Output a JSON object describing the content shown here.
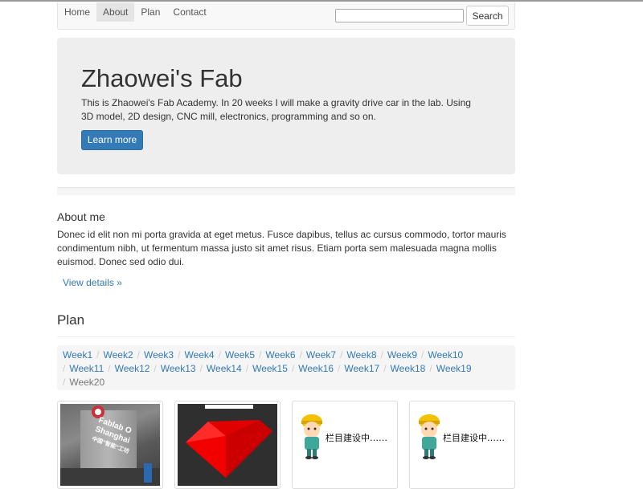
{
  "navbar": {
    "links": [
      "Home",
      "About",
      "Plan",
      "Contact"
    ],
    "active": "About",
    "search": {
      "placeholder": "",
      "button_label": "Search"
    }
  },
  "jumbotron": {
    "title": "Zhaowei's Fab",
    "description": "This is Zhaowei's Fab Academy. In 20 weeks I will make a gravity drive car in the lab. Using 3D model, 2D design, CNC mill, electronics, programming and so on.",
    "button_label": "Learn more",
    "button_color": "#337ab7"
  },
  "about": {
    "title": "About me",
    "text": "Donec id elit non mi porta gravida at eget metus. Fusce dapibus, tellus ac cursus commodo, tortor mauris condimentum nibh, ut fermentum massa justo sit amet risus. Etiam porta sem malesuada magna mollis euismod. Donec sed odio dui.",
    "link_label": "View details »"
  },
  "plan": {
    "title": "Plan",
    "weeks": [
      "Week1",
      "Week2",
      "Week3",
      "Week4",
      "Week5",
      "Week6",
      "Week7",
      "Week8",
      "Week9",
      "Week10",
      "Week11",
      "Week12",
      "Week13",
      "Week14",
      "Week15",
      "Week16",
      "Week17",
      "Week18",
      "Week19",
      "Week20"
    ],
    "current_week": "Week20"
  },
  "thumbnails": {
    "photo": {
      "logo_line1": "Fablab O",
      "logo_line2": "Shanghai",
      "logo_line3": "中国\"智能\"工坊"
    },
    "construction_text": "栏目建设中……"
  }
}
